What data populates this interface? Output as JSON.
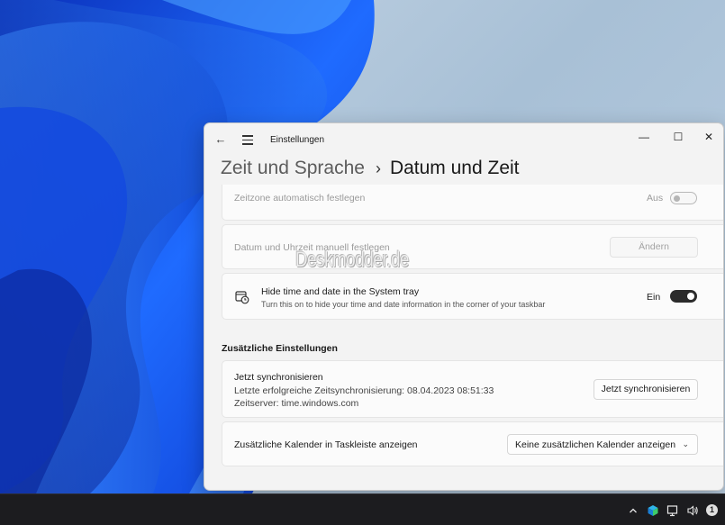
{
  "window": {
    "title": "Einstellungen",
    "controls": {
      "minimize": "—",
      "maximize": "☐",
      "close": "✕"
    }
  },
  "breadcrumb": {
    "parent": "Zeit und Sprache",
    "separator": "›",
    "current": "Datum und Zeit"
  },
  "settings": {
    "auto_timezone": {
      "label": "Zeitzone automatisch festlegen",
      "state": "Aus",
      "enabled": false
    },
    "manual_datetime": {
      "label": "Datum und Uhrzeit manuell festlegen",
      "button": "Ändern",
      "enabled": false
    },
    "hide_tray": {
      "title": "Hide time and date in the System tray",
      "description": "Turn this on to hide your time and date information in the corner of your taskbar",
      "state": "Ein",
      "icon": "clock-calendar-icon"
    }
  },
  "additional": {
    "section_title": "Zusätzliche Einstellungen",
    "sync": {
      "title": "Jetzt synchronisieren",
      "last_sync": "Letzte erfolgreiche Zeitsynchronisierung: 08.04.2023 08:51:33",
      "server": "Zeitserver: time.windows.com",
      "button": "Jetzt synchronisieren"
    },
    "calendar": {
      "label": "Zusätzliche Kalender in Taskleiste anzeigen",
      "selected": "Keine zusätzlichen Kalender anzeigen"
    }
  },
  "watermark": "Deskmodder.de",
  "taskbar": {
    "tray_icons": [
      "chevron-up-icon",
      "security-icon",
      "network-icon",
      "volume-icon",
      "notification-icon"
    ],
    "notification_count": "1"
  },
  "colors": {
    "accent": "#2b2b2b",
    "window_bg": "#f3f3f3",
    "card_bg": "#fbfbfb"
  }
}
